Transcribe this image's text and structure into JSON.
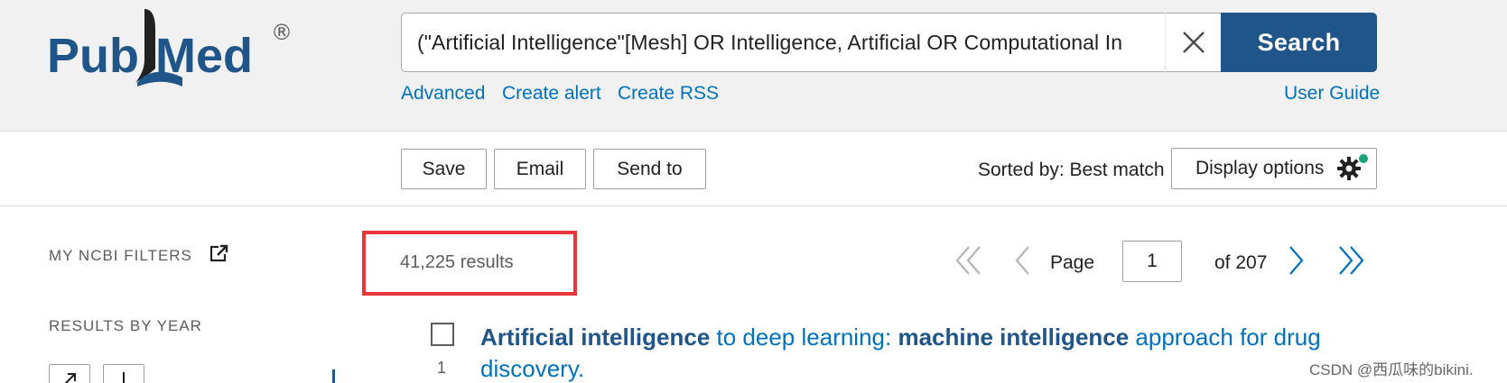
{
  "header": {
    "logo_left": "Pub",
    "logo_right": "Med",
    "logo_mark": "®",
    "search_query": "(\"Artificial Intelligence\"[Mesh] OR Intelligence, Artificial OR Computational In",
    "search_button": "Search",
    "links": [
      "Advanced",
      "Create alert",
      "Create RSS"
    ],
    "user_guide": "User Guide"
  },
  "toolbar": {
    "save_label": "Save",
    "email_label": "Email",
    "send_to_label": "Send to",
    "sorted_by": "Sorted by: Best match",
    "display_options": "Display options"
  },
  "sidebar": {
    "my_ncbi_filters": "MY NCBI FILTERS",
    "results_by_year": "RESULTS BY YEAR"
  },
  "results": {
    "count_text": "41,225 results",
    "page_label": "Page",
    "current_page": "1",
    "of_pages": "of 207",
    "items": [
      {
        "number": "1",
        "title_parts": [
          {
            "text": "Artificial intelligence",
            "bold": true
          },
          {
            "text": " to deep learning: ",
            "bold": false
          },
          {
            "text": "machine intelligence",
            "bold": true
          },
          {
            "text": " approach for drug discovery.",
            "bold": false
          }
        ]
      }
    ]
  },
  "watermark": "CSDN @西瓜味的bikini.",
  "colors": {
    "brand_blue": "#20558a",
    "link_blue": "#0071bc",
    "highlight_red": "#e8363b",
    "indicator_green": "#1aa37a"
  }
}
